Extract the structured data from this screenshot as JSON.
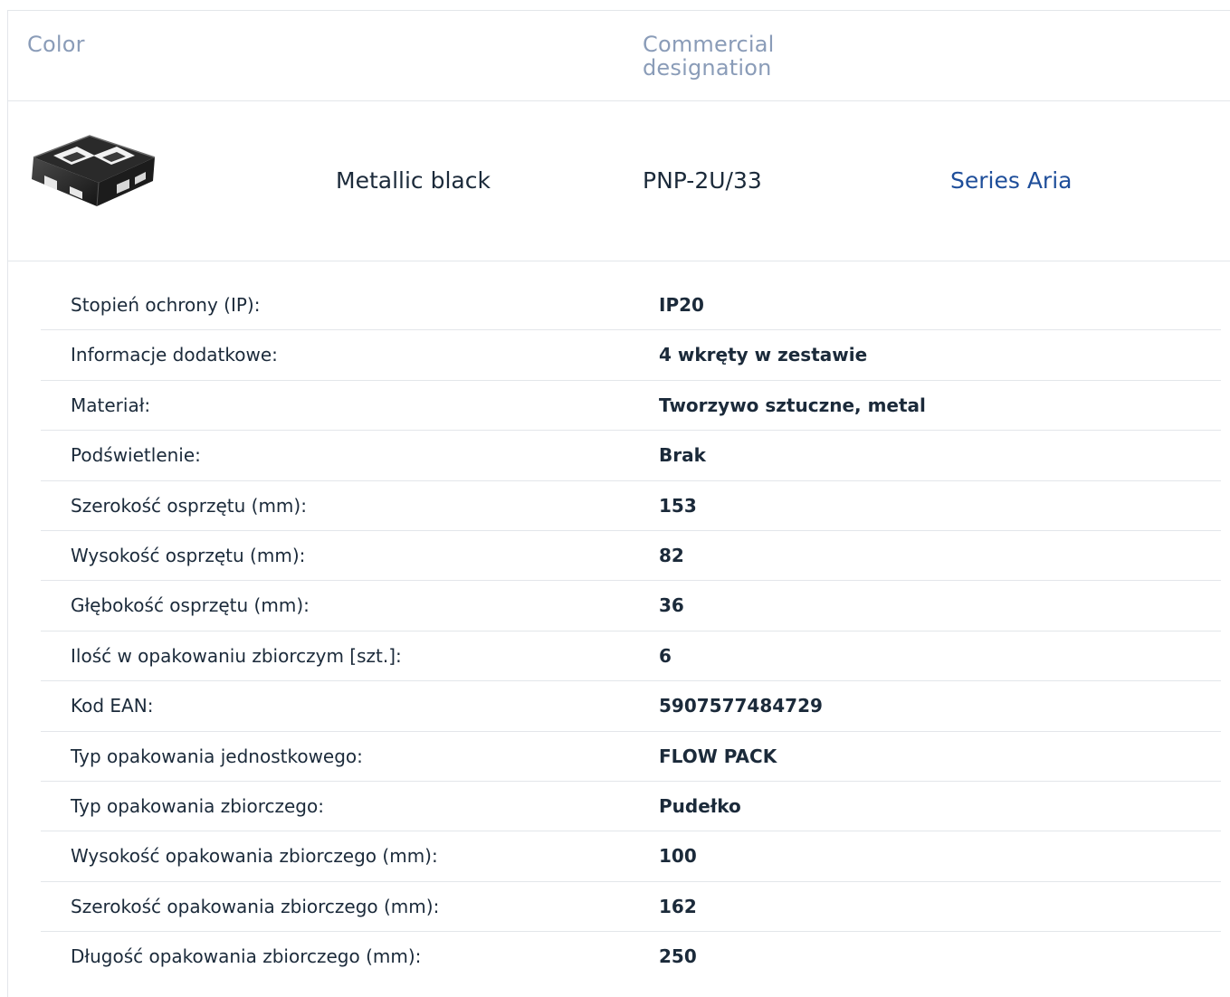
{
  "header": {
    "color_label": "Color",
    "designation_label": "Commercial designation"
  },
  "product": {
    "image_icon": "mounting-frame-thumbnail",
    "color": "Metallic black",
    "code": "PNP-2U/33",
    "series": "Series Aria",
    "series_color": "#1e4e9a"
  },
  "specs": [
    {
      "label": "Stopień ochrony (IP):",
      "value": "IP20"
    },
    {
      "label": "Informacje dodatkowe:",
      "value": "4 wkręty w zestawie"
    },
    {
      "label": "Materiał:",
      "value": "Tworzywo sztuczne, metal"
    },
    {
      "label": "Podświetlenie:",
      "value": "Brak"
    },
    {
      "label": "Szerokość osprzętu (mm):",
      "value": "153"
    },
    {
      "label": "Wysokość osprzętu (mm):",
      "value": "82"
    },
    {
      "label": "Głębokość osprzętu (mm):",
      "value": "36"
    },
    {
      "label": "Ilość w opakowaniu zbiorczym [szt.]:",
      "value": "6"
    },
    {
      "label": "Kod EAN:",
      "value": "5907577484729"
    },
    {
      "label": "Typ opakowania jednostkowego:",
      "value": "FLOW PACK"
    },
    {
      "label": "Typ opakowania zbiorczego:",
      "value": "Pudełko"
    },
    {
      "label": "Wysokość opakowania zbiorczego (mm):",
      "value": "100"
    },
    {
      "label": "Szerokość opakowania zbiorczego (mm):",
      "value": "162"
    },
    {
      "label": "Długość opakowania zbiorczego (mm):",
      "value": "250"
    }
  ]
}
